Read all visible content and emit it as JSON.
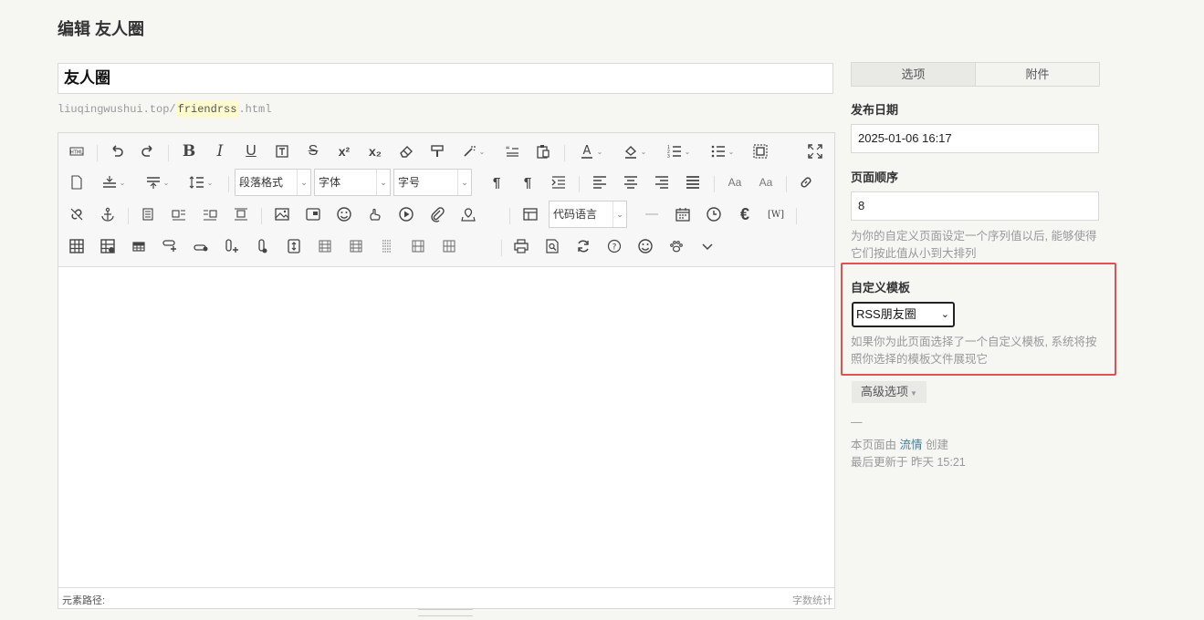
{
  "page": {
    "title": "编辑 友人圈"
  },
  "post": {
    "title": "友人圈",
    "slug_prefix": "liuqingwushui.top/",
    "slug": "friendrss",
    "slug_suffix": ".html"
  },
  "toolbar": {
    "paragraph_format": "段落格式",
    "font_family": "字体",
    "font_size": "字号",
    "code_language": "代码语言"
  },
  "editor": {
    "element_path_label": "元素路径:",
    "word_count_label": "字数统计"
  },
  "sidebar": {
    "tabs": [
      "选项",
      "附件"
    ],
    "publish_date_label": "发布日期",
    "publish_date_value": "2025-01-06 16:17",
    "order_label": "页面顺序",
    "order_value": "8",
    "order_help": "为你的自定义页面设定一个序列值以后, 能够使得它们按此值从小到大排列",
    "template_label": "自定义模板",
    "template_selected": "RSS朋友圈",
    "template_help": "如果你为此页面选择了一个自定义模板, 系统将按照你选择的模板文件展现它",
    "advanced_label": "高级选项",
    "dash": "—",
    "created_prefix": "本页面由",
    "created_author": "流情",
    "created_suffix": "创建",
    "updated": "最后更新于 昨天 15:21"
  },
  "colors": {
    "highlight_border": "#e25151",
    "link": "#467b96",
    "slug_bg": "#fffbcc"
  },
  "icons": {
    "row1": [
      "html-source-icon",
      "undo-icon",
      "redo-icon",
      "bold-icon",
      "italic-icon",
      "underline-icon",
      "border-text-icon",
      "strikethrough-icon",
      "superscript-icon",
      "subscript-icon",
      "eraser-icon",
      "format-painter-icon",
      "auto-format-icon",
      "quote-icon",
      "paste-plain-icon",
      "font-color-icon",
      "background-color-icon",
      "ordered-list-icon",
      "unordered-list-icon",
      "select-all-icon",
      "fullscreen-icon"
    ],
    "row2": [
      "new-doc-icon",
      "row-spacing-top-icon",
      "row-spacing-bottom-icon",
      "line-height-icon",
      "ltr-icon",
      "rtl-icon",
      "indent-icon",
      "align-left-icon",
      "align-center-icon",
      "align-right-icon",
      "justify-icon",
      "case-upper-icon",
      "case-lower-icon",
      "link-icon"
    ],
    "row3": [
      "unlink-icon",
      "anchor-icon",
      "image-none-icon",
      "image-left-icon",
      "image-right-icon",
      "image-center-icon",
      "image-icon",
      "multi-image-icon",
      "emoji-icon",
      "scrawl-icon",
      "video-icon",
      "attachment-icon",
      "map-icon",
      "template-icon",
      "horizontal-rule-icon",
      "date-icon",
      "time-icon",
      "special-char-icon",
      "wordimage-icon"
    ],
    "row4": [
      "insert-table-icon",
      "delete-table-icon",
      "insert-caption-icon",
      "insert-row-above-icon",
      "insert-row-below-icon",
      "insert-col-left-icon",
      "insert-col-right-icon",
      "split-cells-icon",
      "merge-cells-icon",
      "merge-right-icon",
      "merge-down-icon",
      "split-rows-icon",
      "split-cols-icon",
      "print-icon",
      "preview-icon",
      "search-replace-icon",
      "help-icon",
      "face-icon",
      "baidu-paw-icon",
      "more-icon"
    ]
  }
}
